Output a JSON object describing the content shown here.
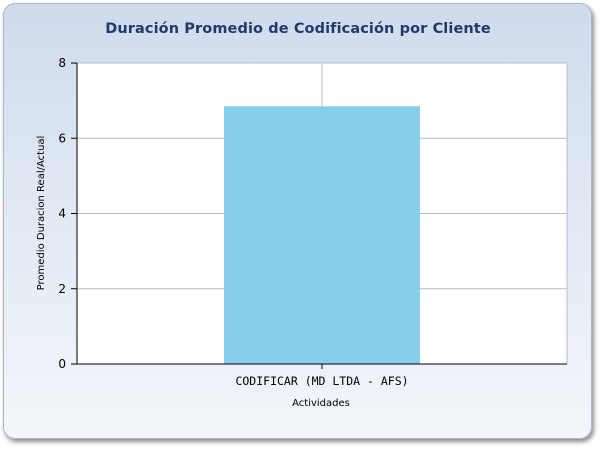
{
  "chart_data": {
    "type": "bar",
    "title": "Duración Promedio de Codificación por Cliente",
    "xlabel": "Actividades",
    "ylabel": "Promedio Duracion Real/Actual",
    "categories": [
      "CODIFICAR (MD LTDA - AFS)"
    ],
    "values": [
      6.85
    ],
    "ylim": [
      0,
      8
    ],
    "yticks": [
      "0",
      "2",
      "4",
      "6",
      "8"
    ],
    "grid": true,
    "legend": "none",
    "bar_color": "#87ceeb"
  }
}
